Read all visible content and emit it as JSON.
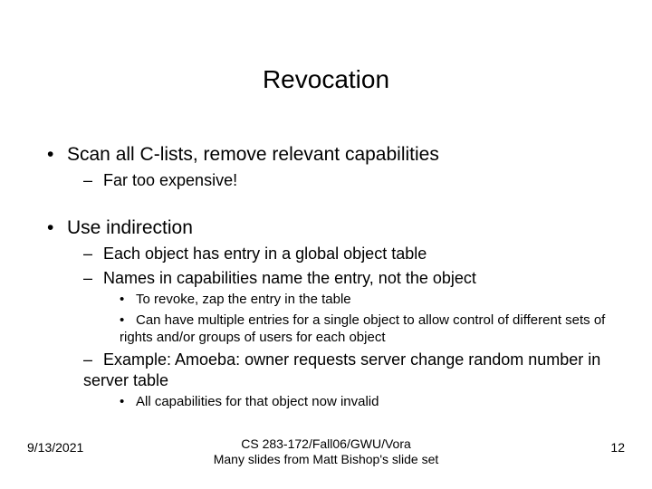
{
  "title": "Revocation",
  "b1": {
    "text": "Scan all C-lists, remove relevant capabilities",
    "sub1": "Far too expensive!"
  },
  "b2": {
    "text": "Use indirection",
    "sub1": "Each object has entry in a global object table",
    "sub2": "Names in capabilities name the entry, not the object",
    "sub2a": "To revoke, zap the entry in the table",
    "sub2b": "Can have multiple entries for a single object to allow control of different sets of rights and/or groups of users for each object",
    "sub3": "Example: Amoeba: owner requests server change random number in server table",
    "sub3a": "All capabilities for that object now invalid"
  },
  "footer": {
    "date": "9/13/2021",
    "line1": "CS 283-172/Fall06/GWU/Vora",
    "line2": "Many slides from Matt Bishop's slide set",
    "page": "12"
  }
}
